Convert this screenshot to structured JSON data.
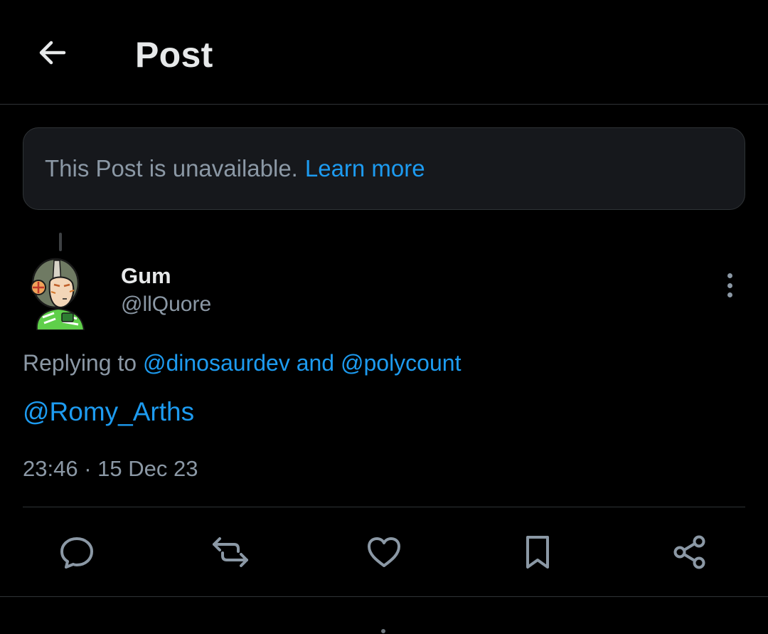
{
  "header": {
    "title": "Post"
  },
  "banner": {
    "text": "This Post is unavailable.",
    "link": "Learn more"
  },
  "author": {
    "name": "Gum",
    "handle": "@llQuore"
  },
  "reply": {
    "prefix": "Replying to",
    "mention_1": "@dinosaurdev",
    "conjunction": "and",
    "mention_2": "@polycount"
  },
  "post": {
    "body": "@Romy_Arths",
    "timestamp": "23:46 · 15 Dec 23"
  },
  "icons": {
    "back": "arrow-left-icon",
    "more": "more-vertical-icon",
    "reply": "reply-icon",
    "repost": "repost-icon",
    "like": "heart-icon",
    "bookmark": "bookmark-icon",
    "share": "share-icon"
  },
  "colors": {
    "background": "#000000",
    "text": "#e7e9ea",
    "muted": "#8b98a5",
    "accent": "#1d9bf0",
    "border": "#2f3336"
  }
}
